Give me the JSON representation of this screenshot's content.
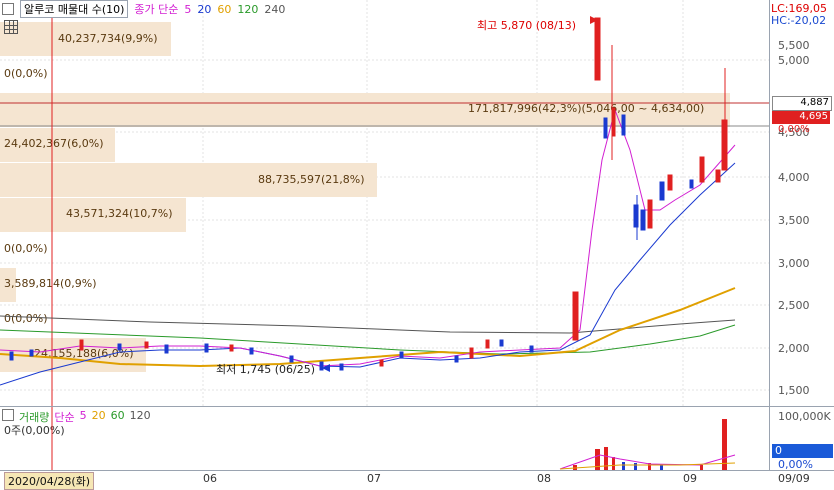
{
  "header": {
    "title": "알루코 매물대 수(10)",
    "ma_title": "종가 단순",
    "ma_periods": [
      "5",
      "20",
      "60",
      "120",
      "240"
    ],
    "ma_colors": [
      "#d21fd2",
      "#1a3ad0",
      "#e0a000",
      "#2a9a2a",
      "#555555"
    ]
  },
  "axis": {
    "lc": "LC:169,05",
    "hc": "HC:-20,02",
    "labels": [
      "5,500",
      "5,000",
      "4,500",
      "4,000",
      "3,500",
      "3,000",
      "2,500",
      "2,000",
      "1,500"
    ],
    "current_high": "4,887",
    "current_price": "4,695",
    "current_pct": "0,00%"
  },
  "volume_profile": [
    {
      "text": "40,237,734(9,9%)"
    },
    {
      "text": "0(0,0%)"
    },
    {
      "text": "171,817,996(42,3%)(5,046,00 ~ 4,634,00)"
    },
    {
      "text": "24,402,367(6,0%)"
    },
    {
      "text": "88,735,597(21,8%)"
    },
    {
      "text": "43,571,324(10,7%)"
    },
    {
      "text": "0(0,0%)"
    },
    {
      "text": "3,589,814(0,9%)"
    },
    {
      "text": "0(0,0%)"
    },
    {
      "text": "24,155,188(6,0%)"
    }
  ],
  "annotations": {
    "high": "최고 5,870 (08/13)",
    "low": "최저 1,745 (06/25)"
  },
  "volume": {
    "title": "거래량",
    "ma_title": "단순",
    "ma_periods": [
      "5",
      "20",
      "60",
      "120"
    ],
    "zero_label": "0주(0,00%)",
    "axis_label": "100,000K",
    "current": "0",
    "current_pct": "0,00%"
  },
  "dates": {
    "cursor": "2020/04/28(화)",
    "ticks": [
      "06",
      "07",
      "08",
      "09"
    ],
    "right": "09/09"
  }
}
